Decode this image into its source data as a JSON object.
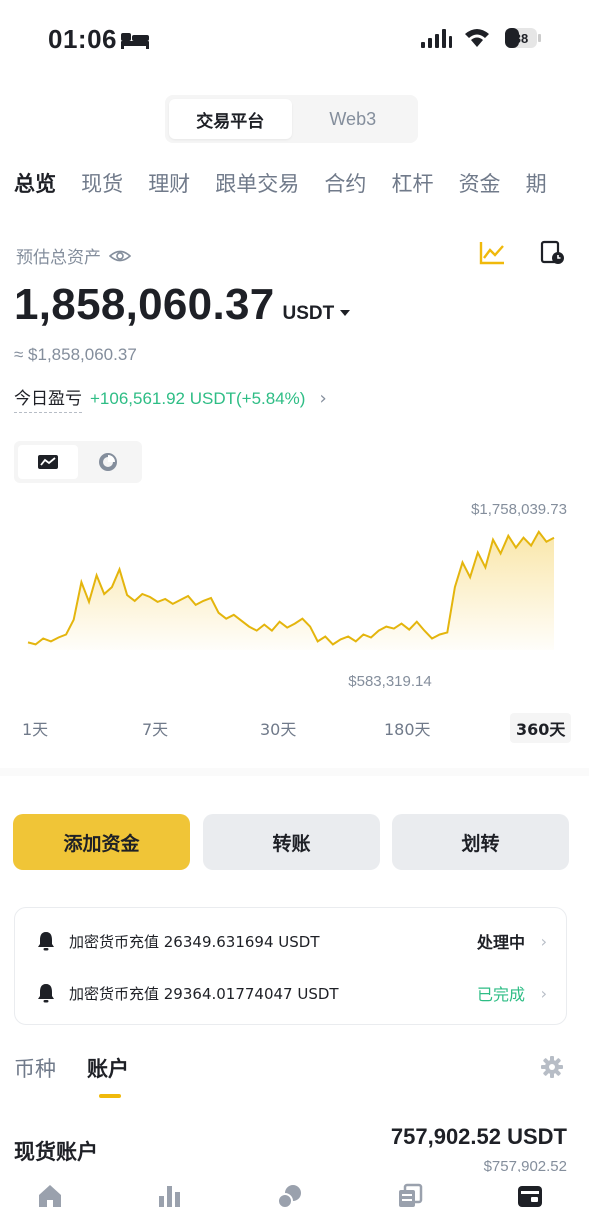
{
  "status_bar": {
    "time": "01:06",
    "battery_level": "38"
  },
  "platform_switch": {
    "tabs": [
      "交易平台",
      "Web3"
    ],
    "active_index": 0
  },
  "nav_tabs": {
    "items": [
      "总览",
      "现货",
      "理财",
      "跟单交易",
      "合约",
      "杠杆",
      "资金",
      "期"
    ],
    "active_index": 0
  },
  "assets": {
    "label": "预估总资产",
    "balance": "1,858,060.37",
    "unit": "USDT",
    "fiat_equivalent": "≈ $1,858,060.37",
    "pnl_label": "今日盈亏",
    "pnl_value": "+106,561.92 USDT(+5.84%)",
    "pnl_chevron": "›"
  },
  "chart_data": {
    "type": "area",
    "max_label": "$1,758,039.73",
    "min_label": "$583,319.14",
    "y_range": [
      583319.14,
      1758039.73
    ],
    "color": "#f0b90b",
    "values": [
      640000,
      620000,
      680000,
      650000,
      690000,
      720000,
      870000,
      1250000,
      1050000,
      1320000,
      1130000,
      1200000,
      1380000,
      1120000,
      1060000,
      1130000,
      1100000,
      1050000,
      1080000,
      1030000,
      1070000,
      1110000,
      1020000,
      1060000,
      1090000,
      940000,
      880000,
      920000,
      860000,
      800000,
      760000,
      820000,
      760000,
      850000,
      790000,
      830000,
      880000,
      800000,
      650000,
      700000,
      620000,
      670000,
      700000,
      650000,
      720000,
      690000,
      760000,
      800000,
      780000,
      830000,
      770000,
      850000,
      760000,
      680000,
      720000,
      740000,
      1200000,
      1450000,
      1300000,
      1550000,
      1400000,
      1680000,
      1540000,
      1720000,
      1600000,
      1700000,
      1620000,
      1760000,
      1660000,
      1700000
    ]
  },
  "range_tabs": {
    "items": [
      "1天",
      "7天",
      "30天",
      "180天",
      "360天"
    ],
    "active_index": 4
  },
  "actions": {
    "deposit": "添加资金",
    "transfer": "转账",
    "internal_transfer": "划转"
  },
  "notifications": [
    {
      "text": "加密货币充值 26349.631694 USDT",
      "status": "处理中",
      "chevron": "›"
    },
    {
      "text": "加密货币充值 29364.01774047 USDT",
      "status": "已完成",
      "chevron": "›"
    }
  ],
  "section_tabs": {
    "items": [
      "币种",
      "账户"
    ],
    "active_index": 1
  },
  "account": {
    "name": "现货账户",
    "amount": "757,902.52 USDT",
    "fiat": "$757,902.52"
  },
  "bottom_nav": {
    "icons": [
      "home-icon",
      "markets-icon",
      "trade-icon",
      "futures-icon",
      "wallet-icon"
    ],
    "active_index": 4
  },
  "colors": {
    "accent": "#f0b90b",
    "button_yellow": "#f0c537",
    "positive": "#2ebd85",
    "muted": "#848e9c"
  }
}
